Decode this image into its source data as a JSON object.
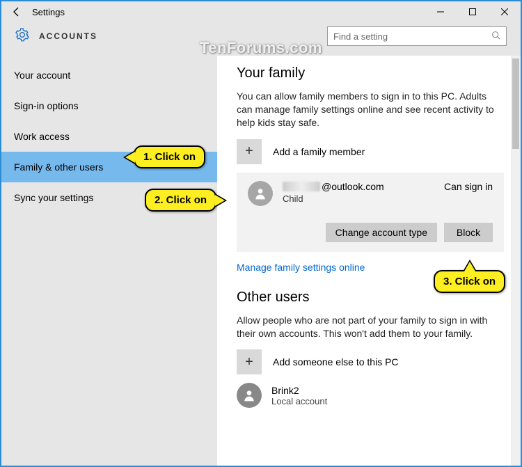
{
  "titlebar": {
    "title": "Settings"
  },
  "header": {
    "section": "ACCOUNTS",
    "search_placeholder": "Find a setting"
  },
  "sidebar": {
    "items": [
      {
        "label": "Your account"
      },
      {
        "label": "Sign-in options"
      },
      {
        "label": "Work access"
      },
      {
        "label": "Family & other users"
      },
      {
        "label": "Sync your settings"
      }
    ],
    "selected_index": 3
  },
  "family": {
    "heading": "Your family",
    "description": "You can allow family members to sign in to this PC. Adults can manage family settings online and see recent activity to help kids stay safe.",
    "add_label": "Add a family member",
    "member": {
      "email_domain": "@outlook.com",
      "role": "Child",
      "status": "Can sign in",
      "change_btn": "Change account type",
      "block_btn": "Block"
    },
    "manage_link": "Manage family settings online"
  },
  "other": {
    "heading": "Other users",
    "description": "Allow people who are not part of your family to sign in with their own accounts. This won't add them to your family.",
    "add_label": "Add someone else to this PC",
    "user": {
      "name": "Brink2",
      "type": "Local account"
    }
  },
  "callouts": {
    "c1": "1. Click on",
    "c2": "2. Click on",
    "c3": "3. Click on"
  },
  "watermark": "TenForums.com"
}
